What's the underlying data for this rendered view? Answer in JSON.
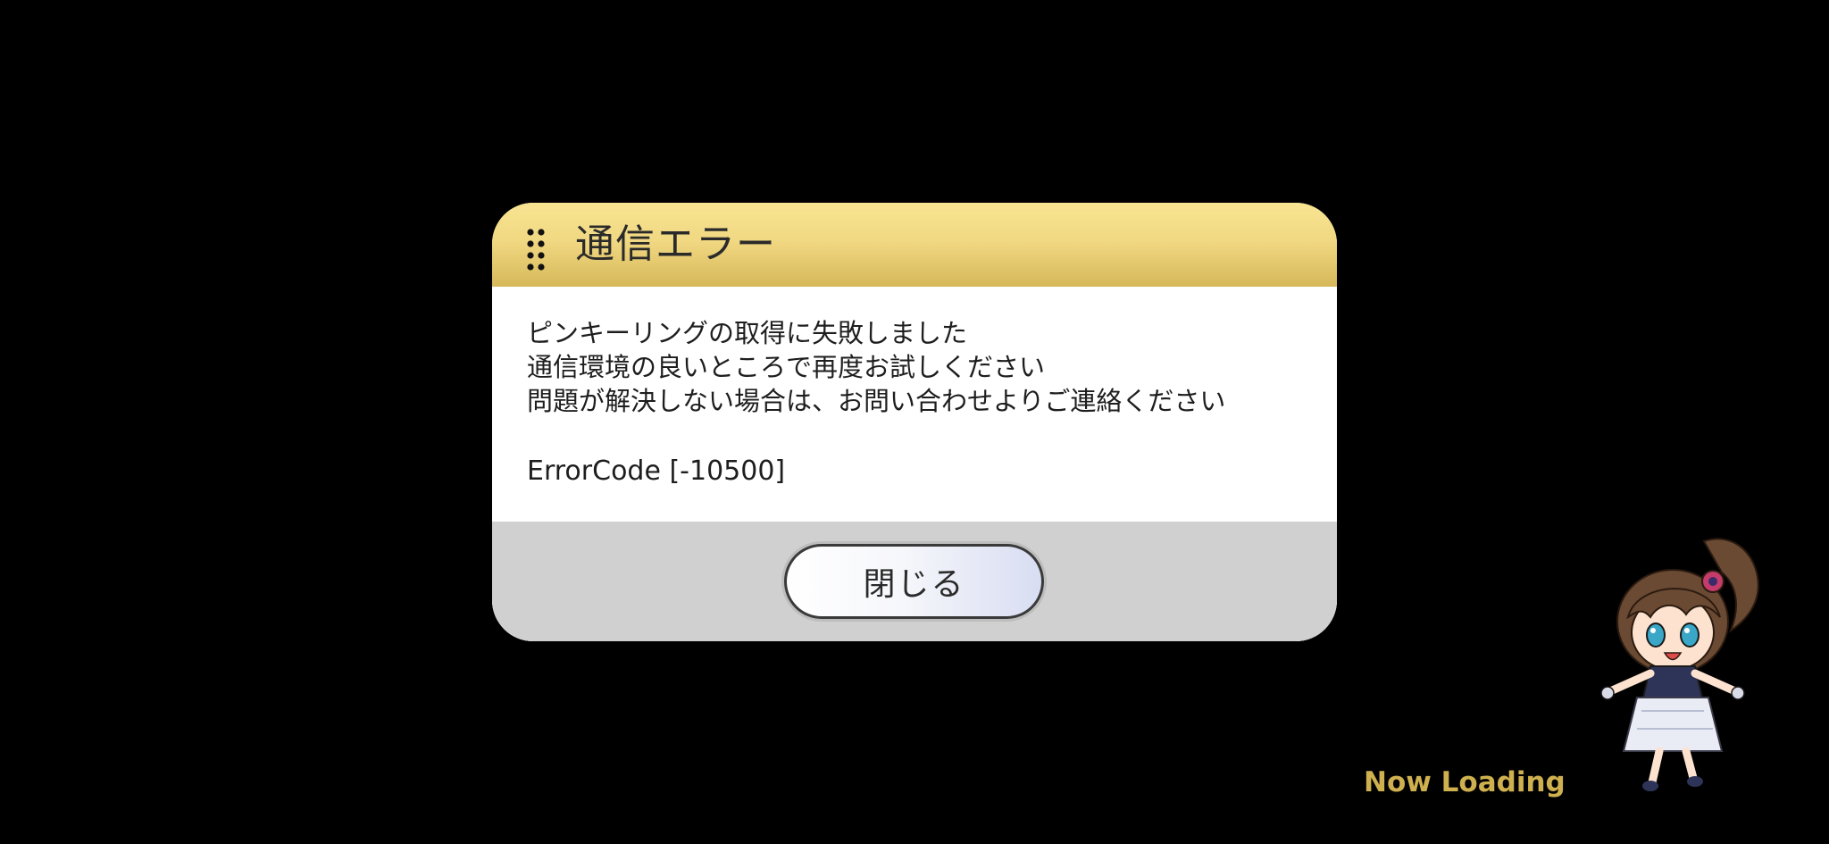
{
  "dialog": {
    "title": "通信エラー",
    "message_lines": [
      "ピンキーリングの取得に失敗しました",
      "通信環境の良いところで再度お試しください",
      "問題が解決しない場合は、お問い合わせよりご連絡ください"
    ],
    "error_code": "ErrorCode [-10500]",
    "close_label": "閉じる"
  },
  "loading": {
    "text": "Now Loading",
    "icon": "chibi-idol-character"
  },
  "colors": {
    "background": "#000000",
    "header_gold": "#f1d882",
    "footer_gray": "#d0d0d0",
    "loading_gold": "#cfb04f"
  }
}
